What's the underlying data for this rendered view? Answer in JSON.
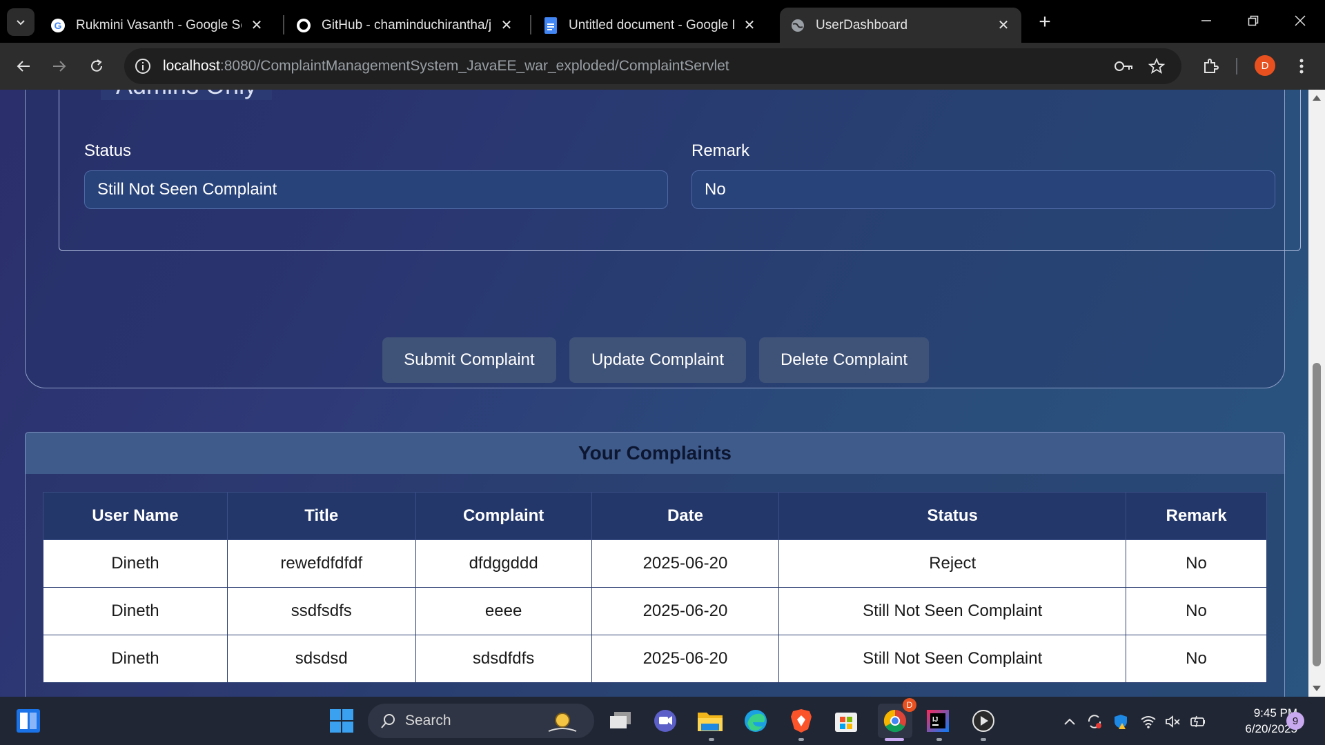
{
  "browser": {
    "tabs": [
      {
        "title": "Rukmini Vasanth - Google Search",
        "icon": "google-icon"
      },
      {
        "title": "GitHub - chaminduchirantha/java",
        "icon": "github-icon"
      },
      {
        "title": "Untitled document - Google Docs",
        "icon": "google-docs-icon"
      },
      {
        "title": "UserDashboard",
        "icon": "globe-icon"
      }
    ],
    "active_tab": 3,
    "url_host": "localhost",
    "url_rest": ":8080/ComplaintManagementSystem_JavaEE_war_exploded/ComplaintServlet",
    "profile_initial": "D"
  },
  "admin_section": {
    "legend": "Admins Only",
    "status_label": "Status",
    "status_value": "Still Not Seen Complaint",
    "remark_label": "Remark",
    "remark_value": "No"
  },
  "actions": {
    "submit": "Submit Complaint",
    "update": "Update Complaint",
    "delete": "Delete Complaint"
  },
  "complaints": {
    "heading": "Your Complaints",
    "columns": [
      "User Name",
      "Title",
      "Complaint",
      "Date",
      "Status",
      "Remark"
    ],
    "rows": [
      [
        "Dineth",
        "rewefdfdfdf",
        "dfdggddd",
        "2025-06-20",
        "Reject",
        "No"
      ],
      [
        "Dineth",
        "ssdfsdfs",
        "eeee",
        "2025-06-20",
        "Still Not Seen Complaint",
        "No"
      ],
      [
        "Dineth",
        "sdsdsd",
        "sdsdfdfs",
        "2025-06-20",
        "Still Not Seen Complaint",
        "No"
      ]
    ]
  },
  "taskbar": {
    "search_placeholder": "Search",
    "time": "9:45 PM",
    "date": "6/20/2025",
    "notification_count": "9",
    "chrome_badge": "D"
  },
  "colors": {
    "page_gradient_start": "#2b2f6b",
    "page_gradient_end": "#2a5580",
    "table_header": "#24376a",
    "card_header": "#3e5b8c",
    "button": "#3f5278"
  }
}
